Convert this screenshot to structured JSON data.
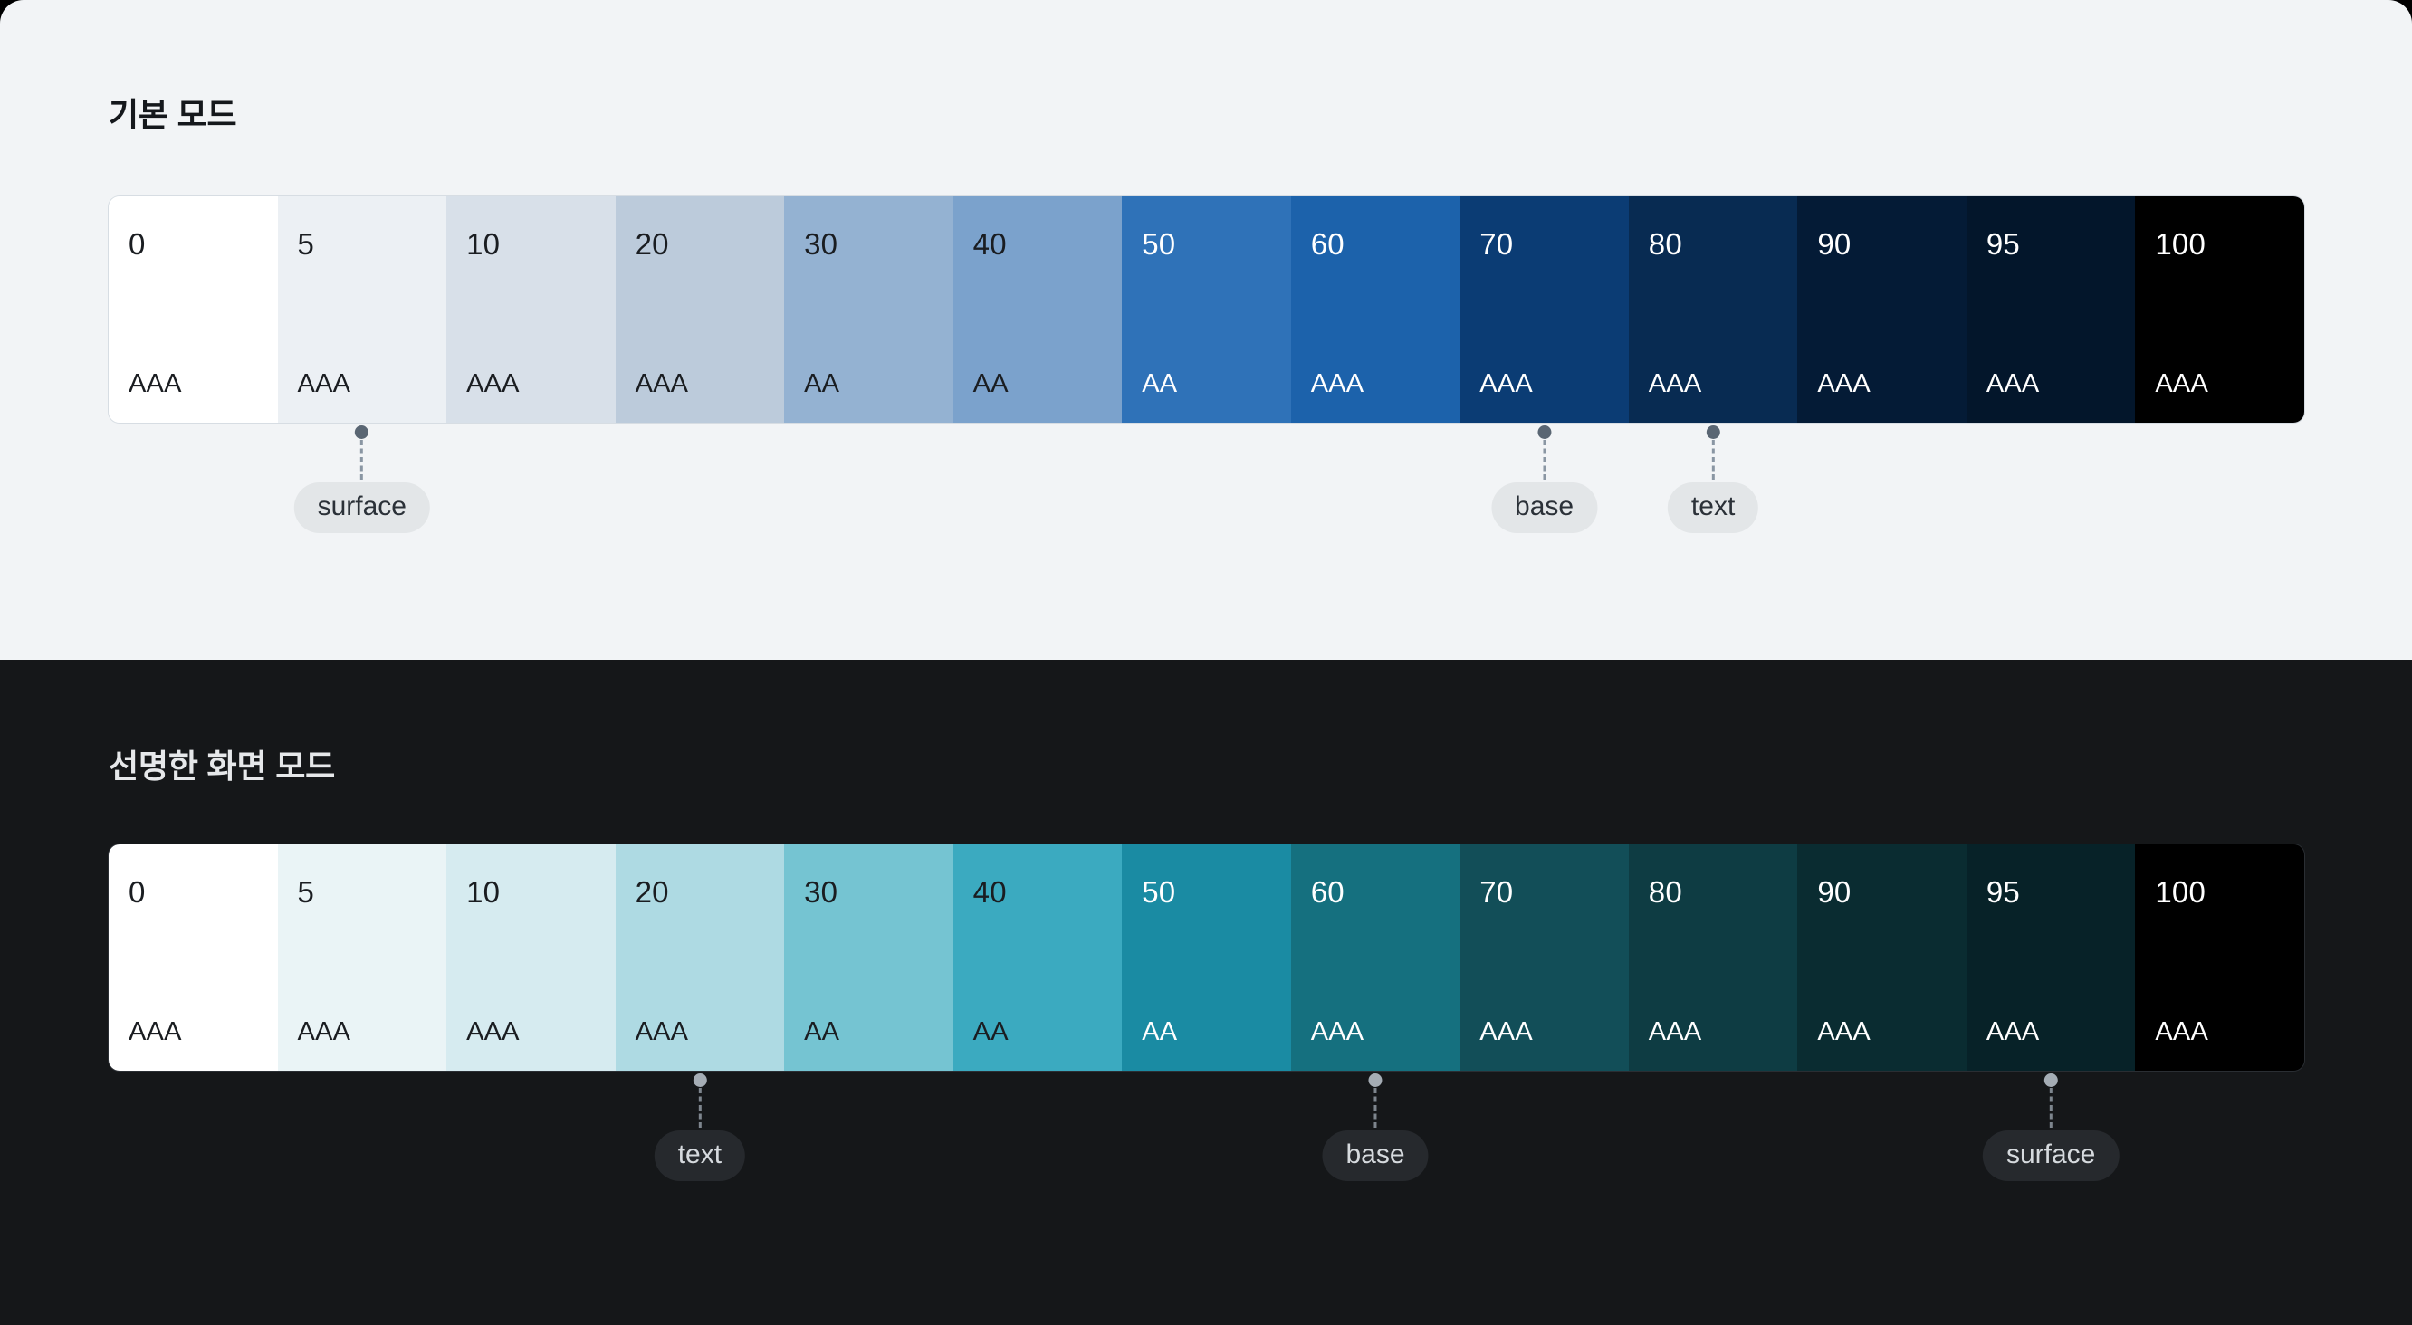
{
  "theme": {
    "page_background": "#000000",
    "light_section_bg": "#F2F4F6",
    "dark_section_bg": "#151719"
  },
  "sections": [
    {
      "id": "default-mode",
      "title": "기본 모드",
      "mode": "light",
      "swatches": [
        {
          "step": "0",
          "rating": "AAA",
          "bg": "#FFFFFF",
          "fg": "#1A1D21"
        },
        {
          "step": "5",
          "rating": "AAA",
          "bg": "#ECF0F4",
          "fg": "#1A1D21"
        },
        {
          "step": "10",
          "rating": "AAA",
          "bg": "#D8E0E9",
          "fg": "#1A1D21"
        },
        {
          "step": "20",
          "rating": "AAA",
          "bg": "#BCCBDB",
          "fg": "#1A1D21"
        },
        {
          "step": "30",
          "rating": "AA",
          "bg": "#94B2D2",
          "fg": "#1A1D21"
        },
        {
          "step": "40",
          "rating": "AA",
          "bg": "#7BA2CC",
          "fg": "#1A1D21"
        },
        {
          "step": "50",
          "rating": "AA",
          "bg": "#2F72B8",
          "fg": "#FFFFFF"
        },
        {
          "step": "60",
          "rating": "AAA",
          "bg": "#1C62AB",
          "fg": "#FFFFFF"
        },
        {
          "step": "70",
          "rating": "AAA",
          "bg": "#0B3C74",
          "fg": "#FFFFFF"
        },
        {
          "step": "80",
          "rating": "AAA",
          "bg": "#082B52",
          "fg": "#FFFFFF"
        },
        {
          "step": "90",
          "rating": "AAA",
          "bg": "#041B36",
          "fg": "#FFFFFF"
        },
        {
          "step": "95",
          "rating": "AAA",
          "bg": "#03162B",
          "fg": "#FFFFFF"
        },
        {
          "step": "100",
          "rating": "AAA",
          "bg": "#000000",
          "fg": "#FFFFFF"
        }
      ],
      "pins": [
        {
          "label": "surface",
          "swatch_index": 1
        },
        {
          "label": "base",
          "swatch_index": 8
        },
        {
          "label": "text",
          "swatch_index": 9
        }
      ]
    },
    {
      "id": "vivid-screen-mode",
      "title": "선명한 화면 모드",
      "mode": "dark",
      "swatches": [
        {
          "step": "0",
          "rating": "AAA",
          "bg": "#FFFFFF",
          "fg": "#1A1D21"
        },
        {
          "step": "5",
          "rating": "AAA",
          "bg": "#EAF4F6",
          "fg": "#1A1D21"
        },
        {
          "step": "10",
          "rating": "AAA",
          "bg": "#D6EBF0",
          "fg": "#1A1D21"
        },
        {
          "step": "20",
          "rating": "AAA",
          "bg": "#AEDAE3",
          "fg": "#1A1D21"
        },
        {
          "step": "30",
          "rating": "AA",
          "bg": "#75C4D2",
          "fg": "#1A1D21"
        },
        {
          "step": "40",
          "rating": "AA",
          "bg": "#3BAAC0",
          "fg": "#1A1D21"
        },
        {
          "step": "50",
          "rating": "AA",
          "bg": "#1A8BA3",
          "fg": "#FFFFFF"
        },
        {
          "step": "60",
          "rating": "AAA",
          "bg": "#15707F",
          "fg": "#FFFFFF"
        },
        {
          "step": "70",
          "rating": "AAA",
          "bg": "#124E58",
          "fg": "#FFFFFF"
        },
        {
          "step": "80",
          "rating": "AAA",
          "bg": "#0E3C43",
          "fg": "#FFFFFF"
        },
        {
          "step": "90",
          "rating": "AAA",
          "bg": "#0A2C31",
          "fg": "#FFFFFF"
        },
        {
          "step": "95",
          "rating": "AAA",
          "bg": "#072228",
          "fg": "#FFFFFF"
        },
        {
          "step": "100",
          "rating": "AAA",
          "bg": "#000000",
          "fg": "#FFFFFF"
        }
      ],
      "pins": [
        {
          "label": "text",
          "swatch_index": 3
        },
        {
          "label": "base",
          "swatch_index": 7
        },
        {
          "label": "surface",
          "swatch_index": 11
        }
      ]
    }
  ]
}
